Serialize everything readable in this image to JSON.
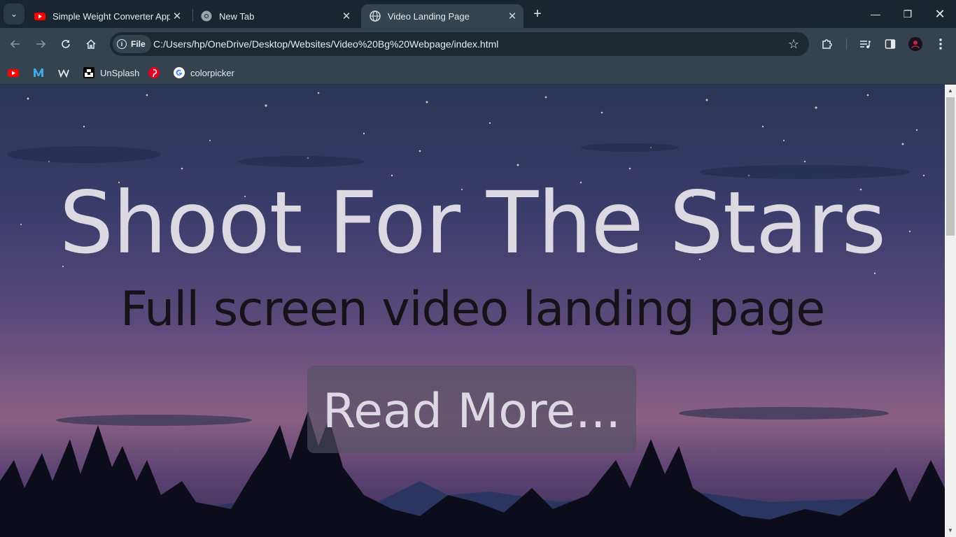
{
  "browser": {
    "tabs": [
      {
        "title": "Simple Weight Converter App W",
        "favicon": "youtube-icon"
      },
      {
        "title": "New Tab",
        "favicon": "chrome-icon"
      },
      {
        "title": "Video Landing Page",
        "favicon": "globe-icon",
        "active": true
      }
    ],
    "address": {
      "chip_label": "File",
      "url": "C:/Users/hp/OneDrive/Desktop/Websites/Video%20Bg%20Webpage/index.html"
    },
    "bookmarks": [
      {
        "label": "",
        "icon": "youtube-icon"
      },
      {
        "label": "",
        "icon": "medium-m-icon"
      },
      {
        "label": "",
        "icon": "w-logo-icon"
      },
      {
        "label": "UnSplash",
        "icon": "unsplash-icon"
      },
      {
        "label": "",
        "icon": "pinterest-icon"
      },
      {
        "label": "colorpicker",
        "icon": "google-icon"
      }
    ]
  },
  "page": {
    "title": "Shoot For The Stars",
    "subtitle": "Full screen video landing page",
    "cta_label": "Read More..."
  },
  "colors": {
    "chrome_dark": "#1a2530",
    "chrome_toolbar": "#35434f",
    "hero_text": "#dcd9e3",
    "subtitle_text": "#161219"
  }
}
